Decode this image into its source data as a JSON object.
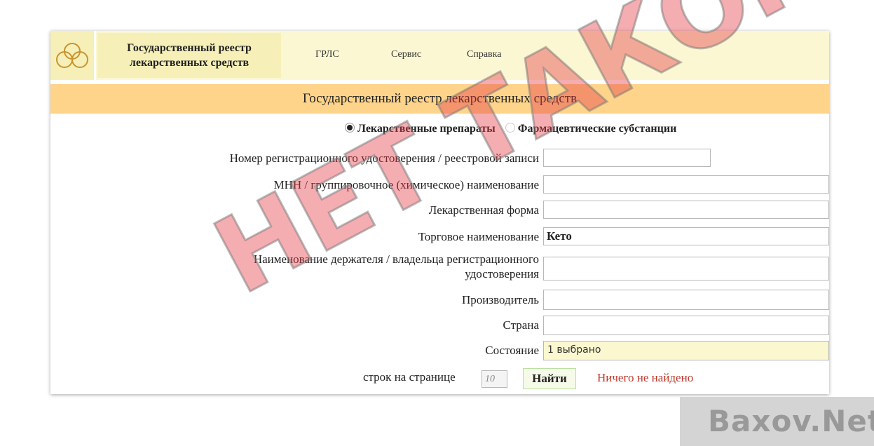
{
  "header": {
    "title_line1": "Государственный реестр",
    "title_line2": "лекарственных средств",
    "nav": [
      "ГРЛС",
      "Сервис",
      "Справка"
    ]
  },
  "banner": "Государственный реестр лекарственных средств",
  "search_type": {
    "option1": "Лекарственные препараты",
    "option2": "Фармацевтические субстанции",
    "selected": "option1"
  },
  "form": {
    "reg_number_label": "Номер регистрационного удостоверения / реестровой записи",
    "mnn_label": "МНН / группировочное (химическое) наименование",
    "dosage_form_label": "Лекарственная форма",
    "trade_name_label": "Торговое наименование",
    "trade_name_value": "Кето",
    "holder_label_line1": "Наименование держателя / владельца регистрационного",
    "holder_label_line2": "удостоверения",
    "manufacturer_label": "Производитель",
    "country_label": "Страна",
    "status_label": "Состояние",
    "status_value": "1 выбрано"
  },
  "footer": {
    "rows_label": "строк на странице",
    "rows_value": "10",
    "search_button": "Найти",
    "result_text": "Ничего не найдено"
  },
  "overlay": {
    "stamp_text": "НЕТ ТАКОГО",
    "watermark": "Baxov.Net"
  }
}
